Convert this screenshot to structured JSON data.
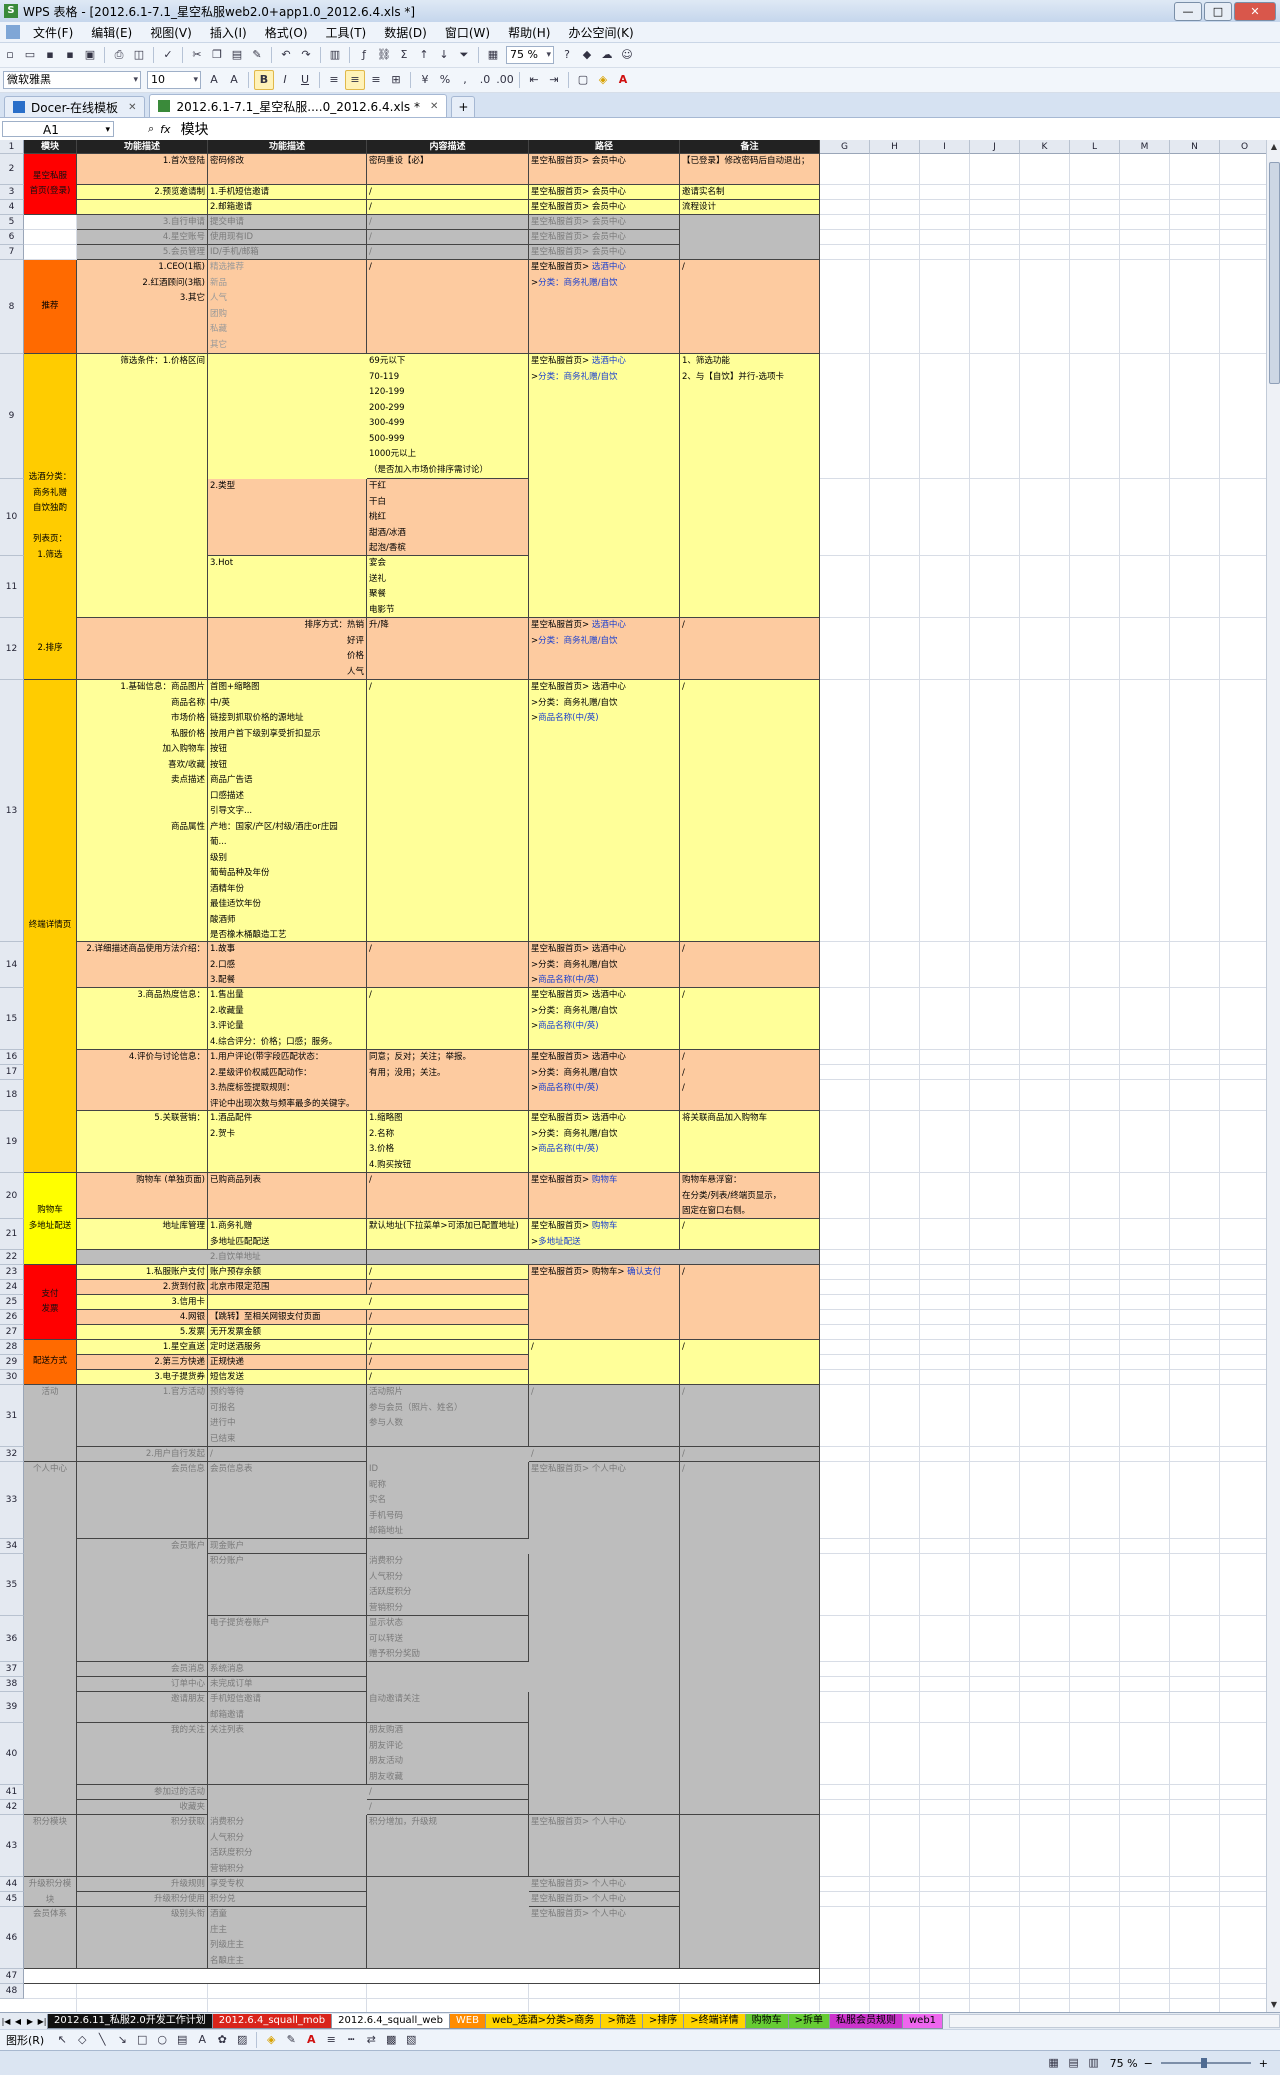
{
  "window": {
    "app_icon": "S",
    "title": "WPS 表格 - [2012.6.1-7.1_星空私服web2.0+app1.0_2012.6.4.xls *]",
    "controls": [
      "—",
      "□",
      "✕"
    ]
  },
  "menu": {
    "items": [
      "文件(F)",
      "编辑(E)",
      "视图(V)",
      "插入(I)",
      "格式(O)",
      "工具(T)",
      "数据(D)",
      "窗口(W)",
      "帮助(H)",
      "办公空间(K)"
    ]
  },
  "toolbar": {
    "zoom": "75 %",
    "font_name": "微软雅黑",
    "font_size": "10",
    "bold": "B",
    "italic": "I",
    "underline": "U",
    "percent": "%",
    "sigma": "Σ"
  },
  "doc_tabs": [
    {
      "label": "Docer-在线模板",
      "active": false
    },
    {
      "label": "2012.6.1-7.1_星空私服....0_2012.6.4.xls *",
      "active": true
    }
  ],
  "doc_tab_plus": "+",
  "formula_bar": {
    "name_box": "A1",
    "fx": "fx",
    "content": "模块"
  },
  "columns": [
    "A",
    "B",
    "C",
    "D",
    "E",
    "F",
    "G",
    "H",
    "I",
    "J",
    "K",
    "L",
    "M",
    "N",
    "O"
  ],
  "header_row": [
    "模块",
    "功能描述",
    "功能描述",
    "内容描述",
    "路径",
    "备注"
  ],
  "row_numbers": [
    "1",
    "2",
    "3",
    "4",
    "5",
    "6",
    "7",
    "8",
    "9",
    "10",
    "11",
    "12",
    "13",
    "14",
    "15",
    "16",
    "17",
    "18",
    "19",
    "20",
    "21",
    "22",
    "23",
    "24",
    "25",
    "26",
    "27",
    "28",
    "29",
    "30",
    "31",
    "32",
    "33",
    "34",
    "35",
    "36",
    "37",
    "38",
    "39",
    "40",
    "41",
    "42",
    "43",
    "44",
    "45",
    "46",
    "47",
    "48"
  ],
  "cells": [
    {
      "id": "r2a",
      "text": "星空私服\n首页(登录)"
    },
    {
      "id": "r2b",
      "text": "1.首次登陆"
    },
    {
      "id": "r2c",
      "text": "密码修改"
    },
    {
      "id": "r2d",
      "text": "密码重设【必】"
    },
    {
      "id": "r2e",
      "text": "星空私服首页> 会员中心"
    },
    {
      "id": "r2f",
      "text": "【已登录】修改密码后自动退出；"
    },
    {
      "id": "r3b",
      "text": "2.预览邀请制"
    },
    {
      "id": "r3c",
      "text": "1.手机短信邀请"
    },
    {
      "id": "r3d",
      "text": "/"
    },
    {
      "id": "r3e",
      "text": "星空私服首页> 会员中心"
    },
    {
      "id": "r3f",
      "text": "邀请实名制"
    },
    {
      "id": "r4c",
      "text": "2.邮箱邀请"
    },
    {
      "id": "r4d",
      "text": "/"
    },
    {
      "id": "r4e",
      "text": "星空私服首页> 会员中心"
    },
    {
      "id": "r4f",
      "text": "流程设计"
    },
    {
      "id": "r5b",
      "text": "3.自行申请"
    },
    {
      "id": "r5c",
      "text": "提交申请"
    },
    {
      "id": "r5d",
      "text": "/"
    },
    {
      "id": "r5e",
      "text": "星空私服首页> 会员中心"
    },
    {
      "id": "r6b",
      "text": "4.星空账号"
    },
    {
      "id": "r6c",
      "text": "使用现有ID"
    },
    {
      "id": "r6d",
      "text": "/"
    },
    {
      "id": "r6e",
      "text": "星空私服首页> 会员中心"
    },
    {
      "id": "r7b",
      "text": "5.会员管理"
    },
    {
      "id": "r7c",
      "text": "ID/手机/邮箱"
    },
    {
      "id": "r7d",
      "text": "/"
    },
    {
      "id": "r7e",
      "text": "星空私服首页> 会员中心"
    },
    {
      "id": "r8a",
      "text": "推荐"
    },
    {
      "id": "r8b",
      "text": "1.CEO(1瓶)\n2.红酒顾问(3瓶)\n3.其它"
    },
    {
      "id": "r8c",
      "text": "精选推荐\n新品\n人气\n团购\n私藏\n其它"
    },
    {
      "id": "r8d",
      "text": "/"
    },
    {
      "id": "r8e",
      "text": "星空私服首页> 选酒中心\n>分类：商务礼赠/自饮"
    },
    {
      "id": "r8f",
      "text": "/"
    },
    {
      "id": "r9a",
      "text": "选酒分类：\n商务礼赠\n自饮独酌\n\n列表页：\n1.筛选"
    },
    {
      "id": "r9b",
      "text": "筛选条件：1.价格区间"
    },
    {
      "id": "r9d",
      "text": "69元以下\n70-119\n120-199\n200-299\n300-499\n500-999\n1000元以上\n（是否加入市场价排序需讨论）"
    },
    {
      "id": "r9e",
      "text": "星空私服首页> 选酒中心\n>分类：商务礼赠/自饮"
    },
    {
      "id": "r9f",
      "text": "1、筛选功能\n2、与【自饮】并行-选项卡"
    },
    {
      "id": "r10c",
      "text": "2.类型"
    },
    {
      "id": "r10d",
      "text": "干红\n干白\n桃红\n甜酒/冰酒\n起泡/香槟"
    },
    {
      "id": "r11c",
      "text": "3.Hot"
    },
    {
      "id": "r11d",
      "text": "宴会\n送礼\n聚餐\n电影节"
    },
    {
      "id": "r12a",
      "text": "2.排序"
    },
    {
      "id": "r12b",
      "text": "排序方式：热销\n好评\n价格\n人气"
    },
    {
      "id": "r12d",
      "text": "升/降"
    },
    {
      "id": "r12e",
      "text": "星空私服首页> 选酒中心\n>分类：商务礼赠/自饮"
    },
    {
      "id": "r12f",
      "text": "/"
    },
    {
      "id": "r13a",
      "text": "终端详情页"
    },
    {
      "id": "r13b",
      "text": "1.基础信息：商品图片\n商品名称\n市场价格\n私服价格\n加入购物车\n喜欢/收藏\n卖点描述\n\n\n商品属性"
    },
    {
      "id": "r13c",
      "text": "首图+缩略图\n中/英\n链接到抓取价格的源地址\n按用户首下级别享受折扣显示\n按钮\n按钮\n商品广告语\n口感描述\n引导文字...\n产地：国家/产区/村级/酒庄or庄园\n葡...\n级别\n葡萄品种及年份\n酒精年份\n最佳适饮年份\n酸酒师\n是否橡木桶酿造工艺"
    },
    {
      "id": "r13d",
      "text": "/"
    },
    {
      "id": "r13e",
      "text": "星空私服首页> 选酒中心\n>分类：商务礼赠/自饮\n>商品名称(中/英)"
    },
    {
      "id": "r13f",
      "text": "/"
    },
    {
      "id": "r14b",
      "text": "2.详细描述商品使用方法介绍："
    },
    {
      "id": "r14c",
      "text": "1.故事\n2.口感\n3.配餐"
    },
    {
      "id": "r14d",
      "text": "/"
    },
    {
      "id": "r14e",
      "text": "星空私服首页> 选酒中心\n>分类：商务礼赠/自饮\n>商品名称(中/英)"
    },
    {
      "id": "r14f",
      "text": "/"
    },
    {
      "id": "r15b",
      "text": "3.商品热度信息："
    },
    {
      "id": "r15c",
      "text": "1.售出量\n2.收藏量\n3.评论量\n4.综合评分：价格；口感；服务。"
    },
    {
      "id": "r15d",
      "text": "/"
    },
    {
      "id": "r15e",
      "text": "星空私服首页> 选酒中心\n>分类：商务礼赠/自饮\n>商品名称(中/英)"
    },
    {
      "id": "r15f",
      "text": "/"
    },
    {
      "id": "r16b",
      "text": "4.评价与讨论信息："
    },
    {
      "id": "r16c",
      "text": "1.用户评论(带字段匹配状态：\n2.星级评价权威匹配动作：\n3.热度标签提取规则：\n评论中出现次数与频率最多的关键字。"
    },
    {
      "id": "r16d",
      "text": "同意；反对；关注；举报。\n有用；没用；关注。"
    },
    {
      "id": "r16e",
      "text": "星空私服首页> 选酒中心\n>分类：商务礼赠/自饮\n>商品名称(中/英)"
    },
    {
      "id": "r16f",
      "text": "/\n/\n/"
    },
    {
      "id": "r19b",
      "text": "5.关联营销："
    },
    {
      "id": "r19c",
      "text": "1.酒品配件\n2.贺卡"
    },
    {
      "id": "r19d",
      "text": "1.缩略图\n2.名称\n3.价格\n4.购买按钮"
    },
    {
      "id": "r19e",
      "text": "星空私服首页> 选酒中心\n>分类：商务礼赠/自饮\n>商品名称(中/英)"
    },
    {
      "id": "r19f",
      "text": "将关联商品加入购物车"
    },
    {
      "id": "r20a",
      "text": "购物车\n多地址配送"
    },
    {
      "id": "r20b",
      "text": "购物车 (单独页面)"
    },
    {
      "id": "r20c",
      "text": "已购商品列表"
    },
    {
      "id": "r20d",
      "text": "/"
    },
    {
      "id": "r20e",
      "text": "星空私服首页> 购物车"
    },
    {
      "id": "r20f",
      "text": "购物车悬浮窗：\n在分类/列表/终端页显示，\n固定在窗口右侧。"
    },
    {
      "id": "r21b",
      "text": "地址库管理"
    },
    {
      "id": "r21c",
      "text": "1.商务礼赠\n多地址匹配配送"
    },
    {
      "id": "r21d",
      "text": "默认地址(下拉菜单>可添加已配置地址)"
    },
    {
      "id": "r21e",
      "text": "星空私服首页> 购物车\n>多地址配送"
    },
    {
      "id": "r21f",
      "text": "/"
    },
    {
      "id": "r22c",
      "text": "2.自饮单地址"
    },
    {
      "id": "r23a",
      "text": "支付\n发票"
    },
    {
      "id": "r23b",
      "text": "1.私服账户支付"
    },
    {
      "id": "r23c",
      "text": "账户预存余额"
    },
    {
      "id": "r23d",
      "text": "/"
    },
    {
      "id": "r23e",
      "text": "星空私服首页> 购物车> 确认支付"
    },
    {
      "id": "r23f",
      "text": "/"
    },
    {
      "id": "r24b",
      "text": "2.货到付款"
    },
    {
      "id": "r24c",
      "text": "北京市限定范围"
    },
    {
      "id": "r24d",
      "text": "/"
    },
    {
      "id": "r25b",
      "text": "3.信用卡"
    },
    {
      "id": "r25d",
      "text": "/"
    },
    {
      "id": "r26b",
      "text": "4.网银"
    },
    {
      "id": "r26c",
      "text": "【跳转】至相关网银支付页面"
    },
    {
      "id": "r26d",
      "text": "/"
    },
    {
      "id": "r27b",
      "text": "5.发票"
    },
    {
      "id": "r27c",
      "text": "无开发票金额"
    },
    {
      "id": "r27d",
      "text": "/"
    },
    {
      "id": "r28a",
      "text": "配送方式"
    },
    {
      "id": "r28b",
      "text": "1.星空直送"
    },
    {
      "id": "r28c",
      "text": "定时送酒服务"
    },
    {
      "id": "r28d",
      "text": "/"
    },
    {
      "id": "r28e",
      "text": "/"
    },
    {
      "id": "r28f",
      "text": "/"
    },
    {
      "id": "r29b",
      "text": "2.第三方快递"
    },
    {
      "id": "r29c",
      "text": "正规快递"
    },
    {
      "id": "r29d",
      "text": "/"
    },
    {
      "id": "r30b",
      "text": "3.电子提货券"
    },
    {
      "id": "r30c",
      "text": "短信发送"
    },
    {
      "id": "r30d",
      "text": "/"
    },
    {
      "id": "r31a",
      "text": "活动"
    },
    {
      "id": "r31b",
      "text": "1.官方活动"
    },
    {
      "id": "r31c",
      "text": "预约等待\n可报名\n进行中\n已结束"
    },
    {
      "id": "r31d",
      "text": "活动照片\n参与会员（照片、姓名）\n参与人数"
    },
    {
      "id": "r31e",
      "text": "/"
    },
    {
      "id": "r31f",
      "text": "/"
    },
    {
      "id": "r32b",
      "text": "2.用户自行发起"
    },
    {
      "id": "r32c",
      "text": "/"
    },
    {
      "id": "r32e",
      "text": "/"
    },
    {
      "id": "r32f",
      "text": "/"
    },
    {
      "id": "r33a",
      "text": "个人中心"
    },
    {
      "id": "r33b",
      "text": "会员信息"
    },
    {
      "id": "r33c",
      "text": "会员信息表"
    },
    {
      "id": "r33d",
      "text": "ID\n昵称\n实名\n手机号码\n邮箱地址"
    },
    {
      "id": "r33e",
      "text": "星空私服首页> 个人中心"
    },
    {
      "id": "r33f",
      "text": "/"
    },
    {
      "id": "r34b",
      "text": "会员账户"
    },
    {
      "id": "r34c",
      "text": "现金账户"
    },
    {
      "id": "r35c",
      "text": "积分账户"
    },
    {
      "id": "r35d",
      "text": "消费积分\n人气积分\n活跃度积分\n营销积分"
    },
    {
      "id": "r36c",
      "text": "电子提货卷账户"
    },
    {
      "id": "r36d",
      "text": "显示状态\n可以转送\n赠予积分奖励"
    },
    {
      "id": "r37b",
      "text": "会员消息"
    },
    {
      "id": "r37c",
      "text": "系统消息"
    },
    {
      "id": "r38b",
      "text": "订单中心"
    },
    {
      "id": "r38c",
      "text": "未完成订单"
    },
    {
      "id": "r39b",
      "text": "邀请朋友"
    },
    {
      "id": "r39c",
      "text": "手机短信邀请\n邮箱邀请"
    },
    {
      "id": "r39d",
      "text": "自动邀请关注"
    },
    {
      "id": "r40b",
      "text": "我的关注"
    },
    {
      "id": "r40c",
      "text": "关注列表"
    },
    {
      "id": "r40d",
      "text": "朋友购酒\n朋友评论\n朋友活动\n朋友收藏"
    },
    {
      "id": "r41b",
      "text": "参加过的活动"
    },
    {
      "id": "r41d",
      "text": "/"
    },
    {
      "id": "r42b",
      "text": "收藏夹"
    },
    {
      "id": "r42d",
      "text": "/"
    },
    {
      "id": "r43a",
      "text": "积分模块"
    },
    {
      "id": "r43b",
      "text": "积分获取"
    },
    {
      "id": "r43c",
      "text": "消费积分\n人气积分\n活跃度积分\n营销积分"
    },
    {
      "id": "r43d",
      "text": "积分增加，升级规"
    },
    {
      "id": "r43e",
      "text": "星空私服首页> 个人中心"
    },
    {
      "id": "r44a",
      "text": "升级积分模块"
    },
    {
      "id": "r44b",
      "text": "升级规则"
    },
    {
      "id": "r44c",
      "text": "享受专权"
    },
    {
      "id": "r44e",
      "text": "星空私服首页> 个人中心"
    },
    {
      "id": "r45b",
      "text": "升级积分使用"
    },
    {
      "id": "r45c",
      "text": "积分兑"
    },
    {
      "id": "r45e",
      "text": "星空私服首页> 个人中心"
    },
    {
      "id": "r46a",
      "text": "会员体系"
    },
    {
      "id": "r46b",
      "text": "级别头衔"
    },
    {
      "id": "r46c",
      "text": "酒童\n庄主\n列级庄主\n名酿庄主"
    },
    {
      "id": "r46e",
      "text": "星空私服首页> 个人中心"
    }
  ],
  "sheet_tabs": [
    {
      "label": "2012.6.11_私服2.0开发工作计划",
      "color": "#111111",
      "text": "#ffffff"
    },
    {
      "label": "2012.6.4_squall_mob",
      "color": "#d9241b",
      "text": "#ffffff"
    },
    {
      "label": "2012.6.4_squall_web",
      "color": "#ffffff",
      "text": "#000000"
    },
    {
      "label": "WEB",
      "color": "#ff8c00",
      "text": "#ffffff"
    },
    {
      "label": "web_选酒>分类>商务",
      "color": "#ffd400",
      "text": "#000000"
    },
    {
      "label": ">筛选",
      "color": "#ffd400",
      "text": "#000000"
    },
    {
      "label": ">排序",
      "color": "#ffd400",
      "text": "#000000"
    },
    {
      "label": ">终端详情",
      "color": "#ffd400",
      "text": "#000000"
    },
    {
      "label": "购物车",
      "color": "#66cc33",
      "text": "#000000"
    },
    {
      "label": ">拆单",
      "color": "#66cc33",
      "text": "#000000"
    },
    {
      "label": "私服会员规则",
      "color": "#cc33cc",
      "text": "#000000"
    },
    {
      "label": "web1",
      "color": "#ee66ee",
      "text": "#000000"
    }
  ],
  "draw_bar": {
    "label": "图形(R)"
  },
  "status": {
    "zoom": "75 %"
  }
}
